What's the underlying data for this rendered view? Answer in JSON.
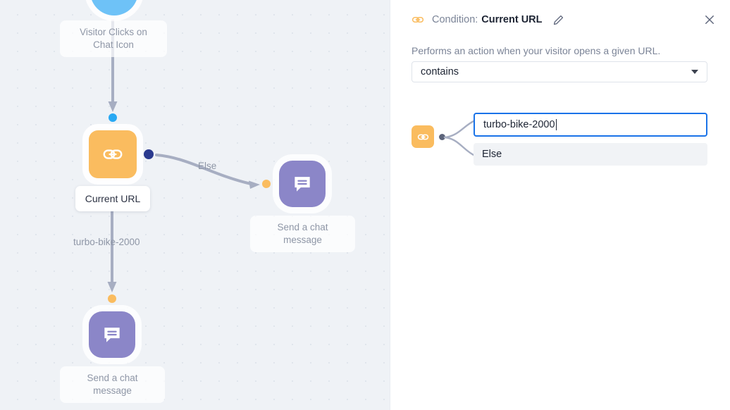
{
  "canvas": {
    "nodes": [
      {
        "id": "trigger",
        "icon": "circle-node-icon",
        "label": "",
        "color": "#6ec2f7"
      },
      {
        "id": "condition",
        "icon": "chain-link-icon",
        "label": "Current URL",
        "color": "#fabc5f"
      },
      {
        "id": "message-else",
        "icon": "chat-message-icon",
        "label": "Send a chat\nmessage",
        "color": "#8b86c8"
      },
      {
        "id": "message-match",
        "icon": "chat-message-icon",
        "label": "Send a chat\nmessage",
        "color": "#8b86c8"
      }
    ],
    "trigger_label": "Visitor Clicks on\nChat Icon",
    "condition_label": "Current URL",
    "message_right_label": "Send a chat\nmessage",
    "message_bottom_label": "Send a chat\nmessage",
    "edge_else_label": "Else",
    "edge_url_label": "turbo-bike-2000",
    "colors": {
      "trigger": "#6ec2f7",
      "condition": "#fabc5f",
      "message": "#8b86c8",
      "edge": "#a7aec2",
      "dot_blue": "#2b3a8f",
      "dot_cyan": "#29a9f3",
      "dot_orange": "#fabc5f",
      "background": "#eff2f6"
    }
  },
  "panel": {
    "header": {
      "chain_icon": "chain-link-icon",
      "prefix": "Condition:",
      "title": "Current URL",
      "edit_icon": "pencil-icon",
      "close_icon": "close-icon"
    },
    "description": "Performs an action when your visitor opens a given URL.",
    "operator_select": {
      "value": "contains",
      "caret_icon": "chevron-down-icon"
    },
    "branch": {
      "icon": "chain-link-icon",
      "input_value": "turbo-bike-2000",
      "else_label": "Else"
    },
    "accent_color": "#1a73e8"
  }
}
